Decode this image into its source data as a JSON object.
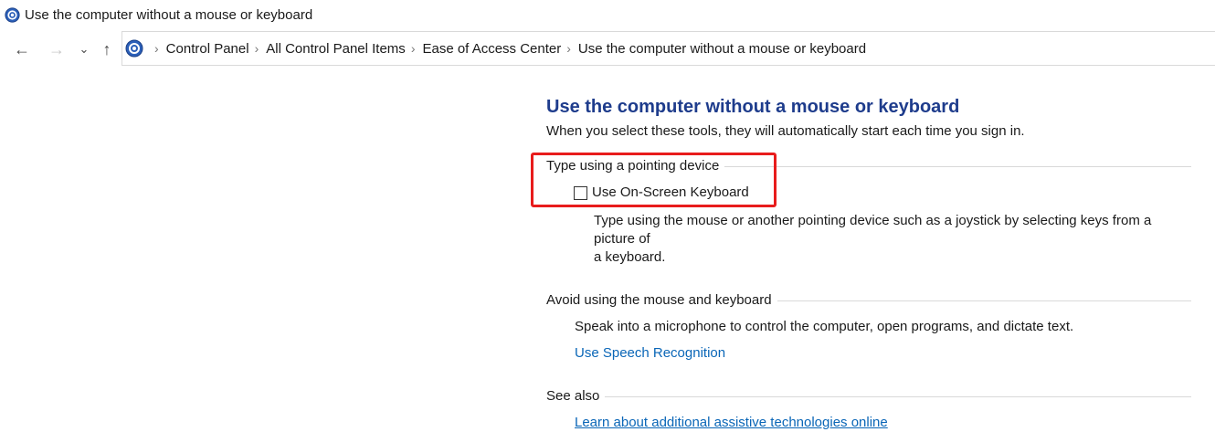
{
  "window": {
    "title": "Use the computer without a mouse or keyboard",
    "icon": "control-panel-icon"
  },
  "nav": {
    "back_icon": "←",
    "forward_icon": "→",
    "recent_icon": "⌄",
    "up_icon": "↑",
    "breadcrumb": [
      "Control Panel",
      "All Control Panel Items",
      "Ease of Access Center",
      "Use the computer without a mouse or keyboard"
    ],
    "separator": "›"
  },
  "main": {
    "title": "Use the computer without a mouse or keyboard",
    "subtitle": "When you select these tools, they will automatically start each time you sign in.",
    "sections": {
      "pointing": {
        "heading": "Type using a pointing device",
        "checkbox_label": "Use On-Screen Keyboard",
        "checked": false,
        "description_line1": "Type using the mouse or another pointing device such as a joystick by selecting keys from a picture of",
        "description_line2": "a keyboard."
      },
      "avoid": {
        "heading": "Avoid using the mouse and keyboard",
        "description": "Speak into a microphone to control the computer, open programs, and dictate text.",
        "link": "Use Speech Recognition"
      },
      "see_also": {
        "heading": "See also",
        "link": "Learn about additional assistive technologies online"
      }
    }
  },
  "colors": {
    "title": "#1e3c8c",
    "link": "#0a66b7",
    "highlight": "#e81c1c"
  }
}
